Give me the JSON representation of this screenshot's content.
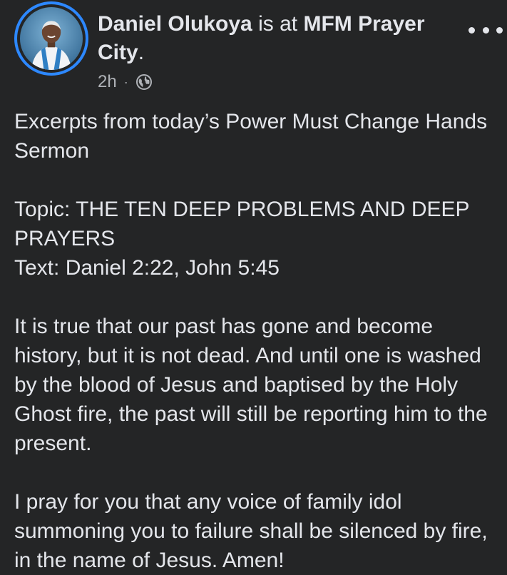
{
  "author": {
    "name": "Daniel Olukoya",
    "action": " is at ",
    "location": "MFM Prayer City",
    "location_suffix": "."
  },
  "meta": {
    "time": "2h",
    "separator": "·",
    "privacy_icon": "globe-icon"
  },
  "post": {
    "paragraph_1": "Excerpts from today’s Power Must Change Hands Sermon",
    "topic": "Topic: THE TEN DEEP PROBLEMS AND DEEP PRAYERS",
    "text_ref": "Text: Daniel 2:22, John 5:45",
    "paragraph_3": "It is true that our past has gone and become history, but it is not dead. And until one is washed by the blood of Jesus and baptised by the Holy Ghost fire, the past will still be reporting him to the present.",
    "paragraph_4": "I pray for you that any voice of family idol summoning you to failure shall be silenced by fire, in the name of Jesus. Amen!"
  },
  "colors": {
    "background": "#242526",
    "text_primary": "#e4e6eb",
    "text_secondary": "#b0b3b8",
    "story_ring": "#2d88ff"
  },
  "icons": {
    "more": "more-options-icon",
    "privacy": "globe-icon"
  }
}
